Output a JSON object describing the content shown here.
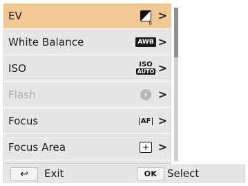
{
  "menu": {
    "items": [
      {
        "label": "EV",
        "icon": "ev-icon",
        "selected": true,
        "disabled": false,
        "ev_value": "0"
      },
      {
        "label": "White Balance",
        "icon": "awb-icon",
        "selected": false,
        "disabled": false,
        "badge": "AWB"
      },
      {
        "label": "ISO",
        "icon": "iso-auto-icon",
        "selected": false,
        "disabled": false,
        "iso_top": "ISO",
        "iso_bottom": "AUTO"
      },
      {
        "label": "Flash",
        "icon": "flash-off-icon",
        "selected": false,
        "disabled": true
      },
      {
        "label": "Focus",
        "icon": "autofocus-icon",
        "selected": false,
        "disabled": false,
        "badge": "AF"
      },
      {
        "label": "Focus Area",
        "icon": "focus-area-icon",
        "selected": false,
        "disabled": false,
        "glyph": "+"
      }
    ],
    "chevron": ">",
    "colors": {
      "selected_bg": "#f1c793",
      "panel_bg": "#e6e6e6"
    }
  },
  "scroll": {
    "position_fraction": 0,
    "visible_fraction": 0.33
  },
  "footer": {
    "exit_label": "Exit",
    "select_label": "Select",
    "ok_label": "OK",
    "back_icon": "back-arrow-icon"
  }
}
